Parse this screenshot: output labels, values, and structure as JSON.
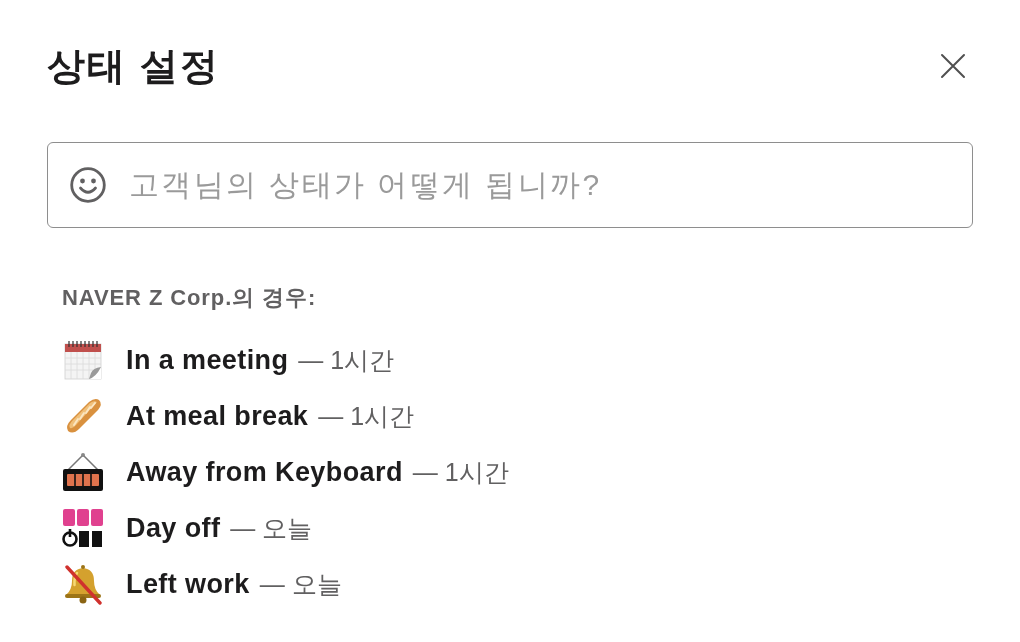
{
  "dialog": {
    "title": "상태 설정"
  },
  "status_field": {
    "placeholder": "고객님의 상태가 어떻게 됩니까?"
  },
  "suggestions": {
    "heading": "NAVER Z Corp.의 경우:",
    "items": [
      {
        "label": "In a meeting",
        "detail": "— 1시간"
      },
      {
        "label": "At meal break",
        "detail": "— 1시간"
      },
      {
        "label": "Away from Keyboard",
        "detail": "— 1시간"
      },
      {
        "label": "Day off",
        "detail": "— 오늘"
      },
      {
        "label": "Left work",
        "detail": "— 오늘"
      }
    ]
  }
}
